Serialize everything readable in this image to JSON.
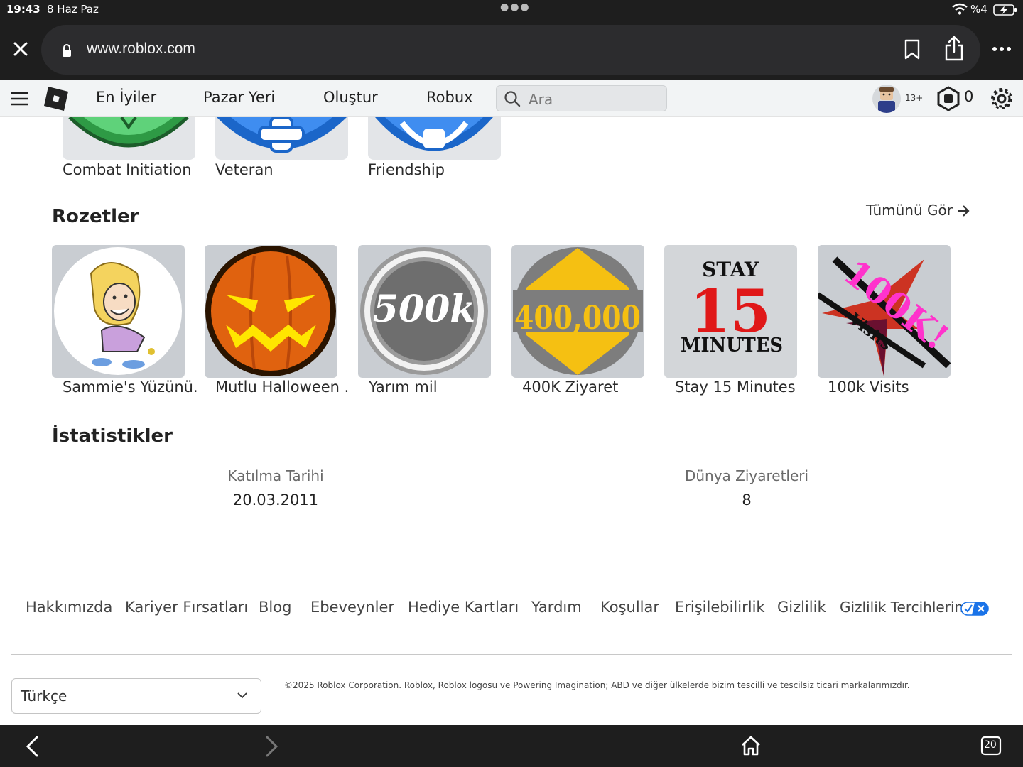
{
  "status_bar": {
    "time": "19:43",
    "date": "8 Haz Paz",
    "battery": "%4"
  },
  "browser": {
    "url": "www.roblox.com",
    "tab_count": "20"
  },
  "header": {
    "nav": [
      "En İyiler",
      "Pazar Yeri",
      "Oluştur",
      "Robux"
    ],
    "search_placeholder": "Ara",
    "age_label": "13+",
    "robux_count": "0"
  },
  "top_badges": [
    "Combat Initiation",
    "Veteran",
    "Friendship"
  ],
  "badges_section": {
    "title": "Rozetler",
    "see_all": "Tümünü Gör",
    "items": [
      {
        "label": "Sammie's Yüzünü...",
        "icon": "cartoon-girl-icon"
      },
      {
        "label": "Mutlu Halloween ...",
        "icon": "pumpkin-face-icon"
      },
      {
        "label": "Yarım mil",
        "icon": "500k-badge-icon",
        "art_text": "500k"
      },
      {
        "label": "400K Ziyaret",
        "icon": "400000-badge-icon",
        "art_text": "400,000"
      },
      {
        "label": "Stay 15 Minutes",
        "icon": "stay-15-minutes-icon",
        "art_top": "STAY",
        "art_mid": "15",
        "art_bot": "MINUTES"
      },
      {
        "label": "100k Visits",
        "icon": "100k-visits-star-icon",
        "art_text": "100K!",
        "art_sub": "Visits"
      }
    ]
  },
  "stats_section": {
    "title": "İstatistikler",
    "join_label": "Katılma Tarihi",
    "join_value": "20.03.2011",
    "visits_label": "Dünya Ziyaretleri",
    "visits_value": "8"
  },
  "footer": {
    "links": [
      "Hakkımızda",
      "Kariyer Fırsatları",
      "Blog",
      "Ebeveynler",
      "Hediye Kartları",
      "Yardım",
      "Koşullar",
      "Erişilebilirlik",
      "Gizlilik",
      "Gizlilik Tercihlerin"
    ],
    "language": "Türkçe",
    "copyright": "©2025 Roblox Corporation. Roblox, Roblox logosu ve Powering Imagination; ABD ve diğer ülkelerde bizim tescilli ve tescilsiz ticari markalarımızdır."
  },
  "colors": {
    "header_bg": "#f2f4f5",
    "card_bg": "#c9cdd2",
    "dark_chrome": "#1e1e1e",
    "toggle_blue": "#1a73e8"
  }
}
